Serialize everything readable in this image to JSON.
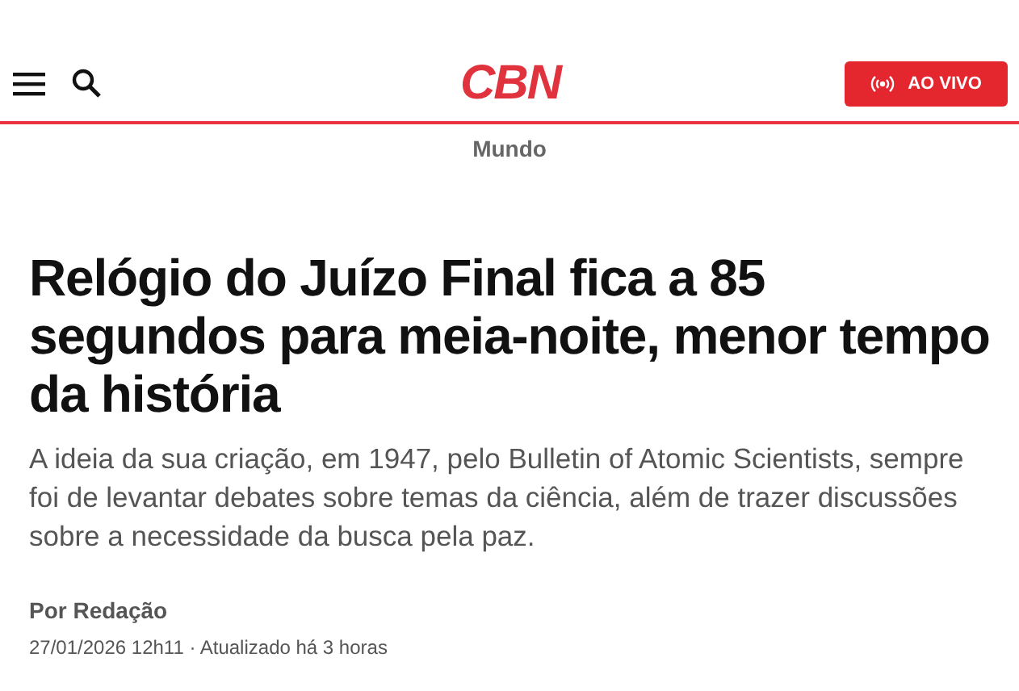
{
  "header": {
    "logo": "CBN",
    "live_button": "AO VIVO"
  },
  "section": "Mundo",
  "article": {
    "title": "Relógio do Juízo Final fica a 85 segundos para meia-noite, menor tempo da história",
    "subtitle": "A ideia da sua criação, em 1947, pelo Bulletin of Atomic Scientists, sempre foi de levantar debates sobre temas da ciência, além de trazer discussões sobre a necessidade da busca pela paz.",
    "author": "Por Redação",
    "date": "27/01/2026 12h11 · Atualizado há 3 horas"
  }
}
